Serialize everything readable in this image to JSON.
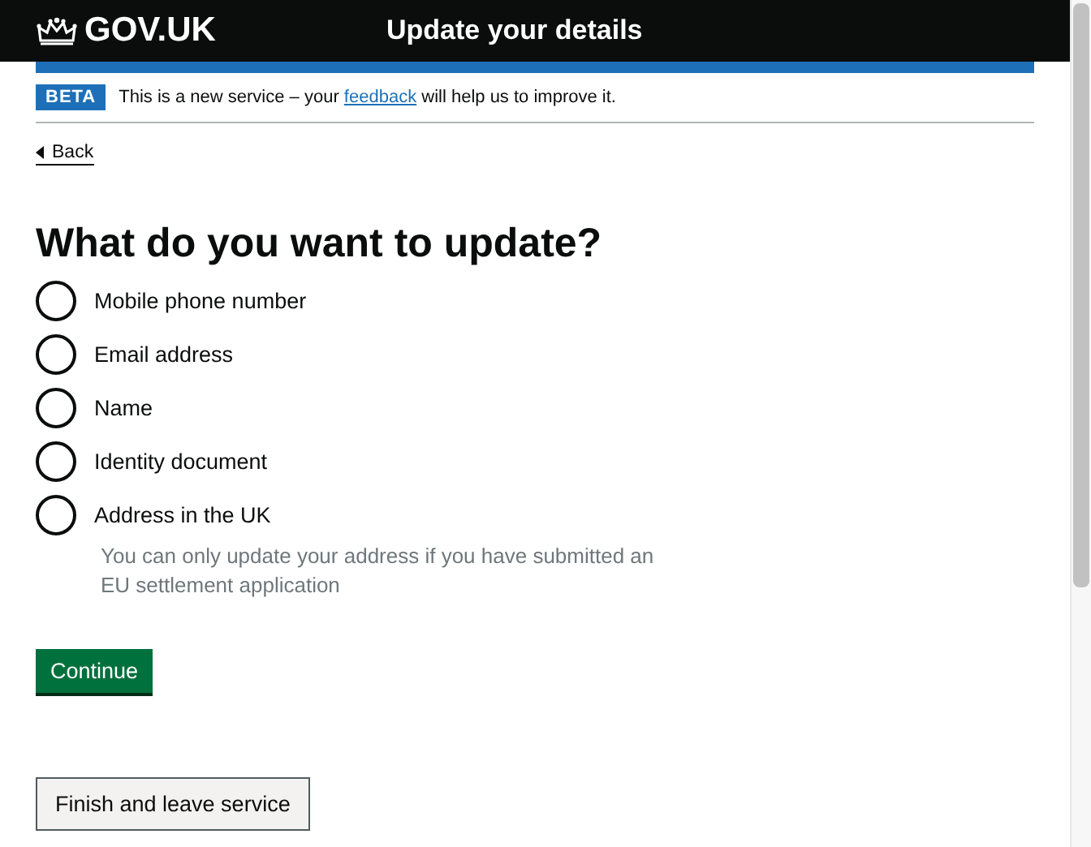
{
  "header": {
    "logo": "GOV.UK",
    "service_name": "Update your details"
  },
  "phase_banner": {
    "tag": "BETA",
    "text_before": "This is a new service – your",
    "link": "feedback",
    "text_after": "will help us to improve it."
  },
  "back_link": "Back",
  "question": "What do you want to update?",
  "options": [
    {
      "label": "Mobile phone number",
      "selected": false
    },
    {
      "label": "Email address",
      "selected": false
    },
    {
      "label": "Name",
      "selected": false
    },
    {
      "label": "Identity document",
      "selected": false
    },
    {
      "label": "Address in the UK",
      "selected": false,
      "hint": "You can only update your address if you have submitted an EU settlement application"
    }
  ],
  "buttons": [
    {
      "label": "Continue",
      "kind": "primary"
    },
    {
      "label": "Finish and leave service",
      "kind": "secondary"
    }
  ]
}
